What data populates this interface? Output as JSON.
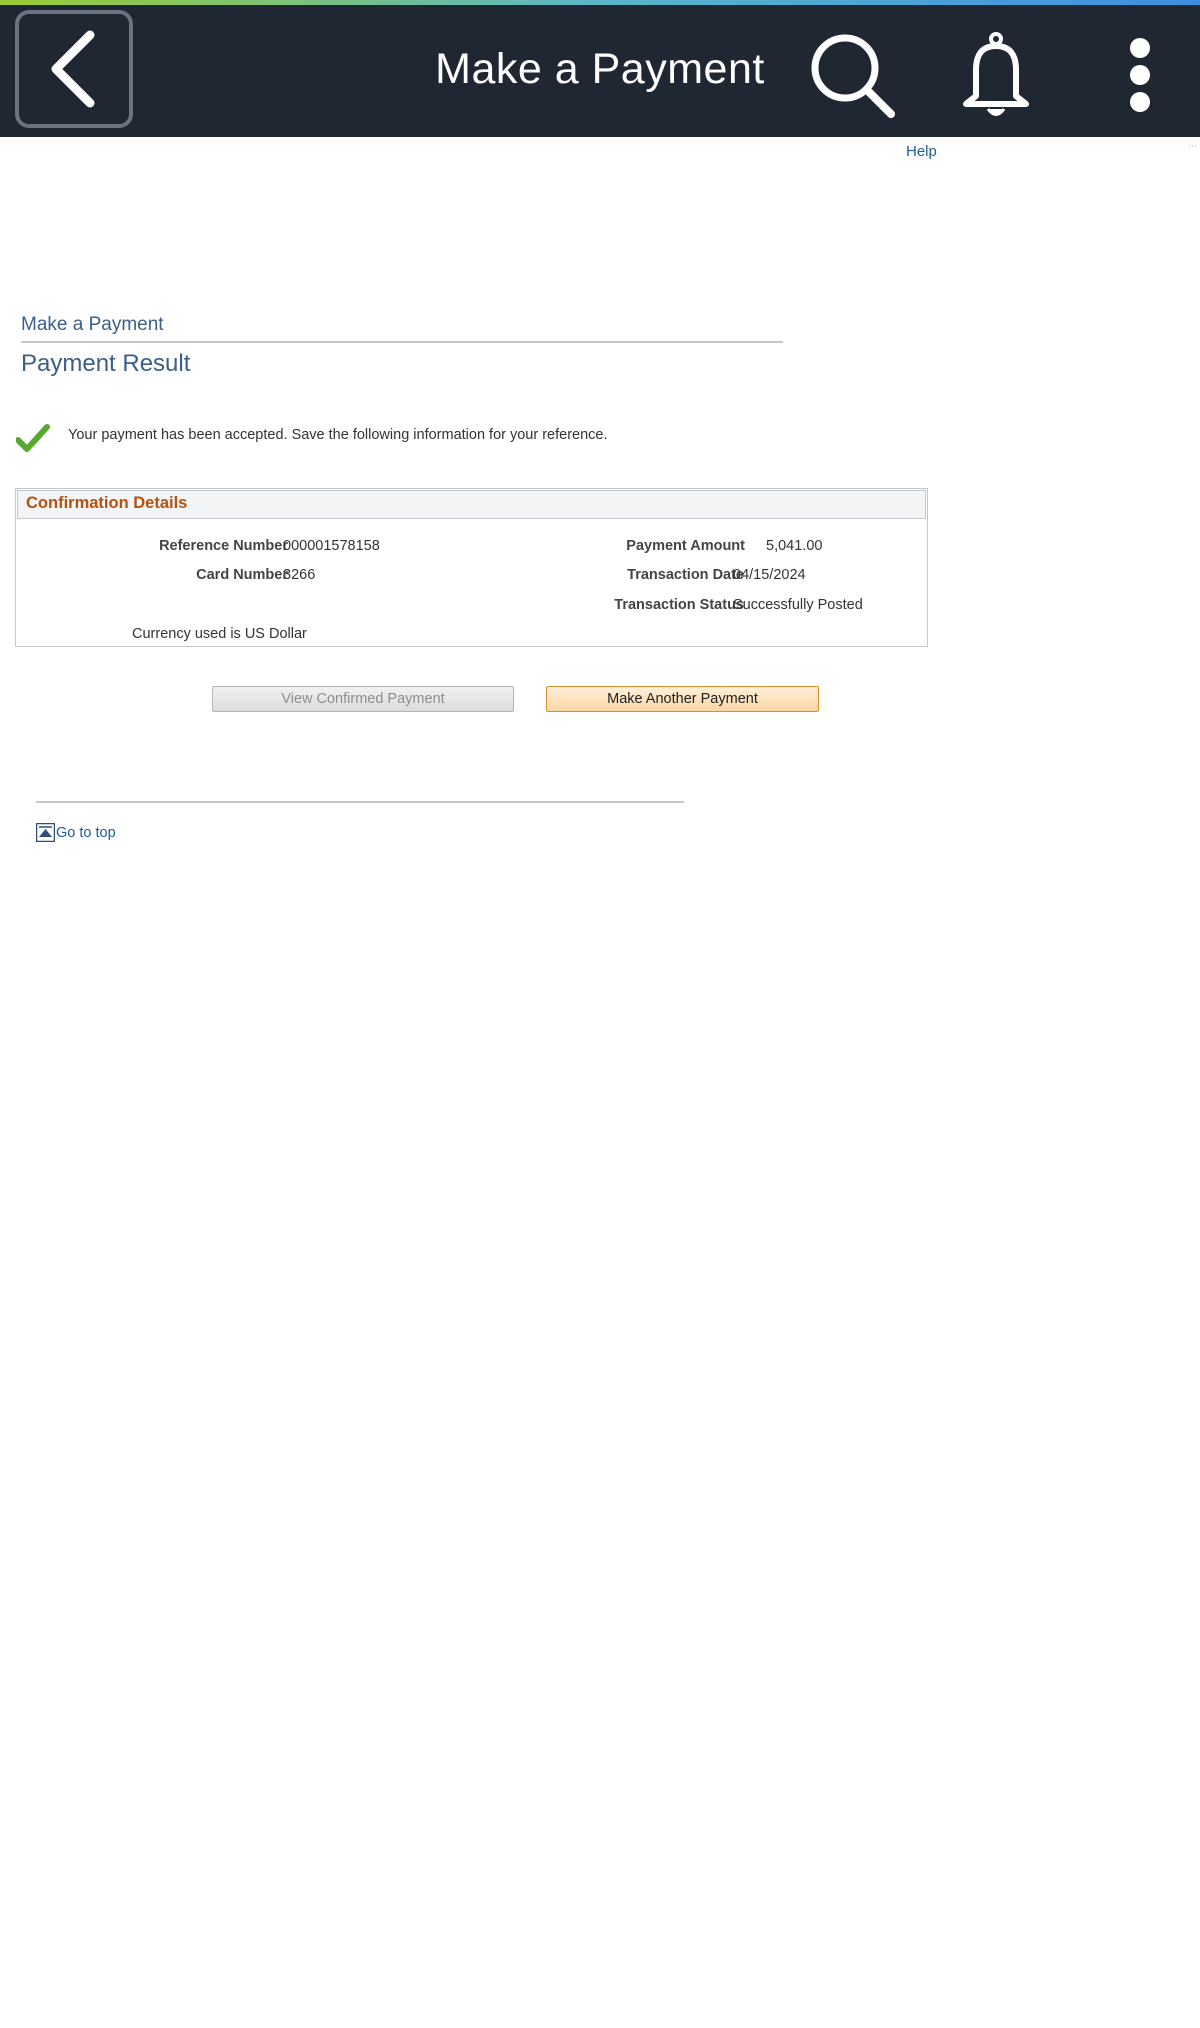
{
  "header": {
    "title": "Make a Payment",
    "icons": [
      "back-chevron-icon",
      "search-icon",
      "bell-icon",
      "more-vertical-icon"
    ]
  },
  "help_link": "Help",
  "breadcrumb": "Make a Payment",
  "page_title": "Payment Result",
  "message": "Your payment has been accepted. Save the following information for your reference.",
  "confirmation": {
    "header": "Confirmation Details",
    "reference_label": "Reference Number",
    "reference_value": "000001578158",
    "card_label": "Card Number",
    "card_value": "3266",
    "amount_label": "Payment Amount",
    "amount_value": "5,041.00",
    "date_label": "Transaction Date",
    "date_value": "04/15/2024",
    "status_label": "Transaction Status",
    "status_value": "Successfully Posted",
    "currency_note": "Currency used is US Dollar"
  },
  "buttons": {
    "view_confirmed": "View Confirmed Payment",
    "make_another": "Make Another Payment"
  },
  "go_to_top": "Go to top",
  "colors": {
    "header_bg": "#1f2733",
    "link": "#1f5c99",
    "title_blue": "#3b5f8a",
    "panel_header_text": "#b5520f",
    "success_check": "#5aa832"
  }
}
